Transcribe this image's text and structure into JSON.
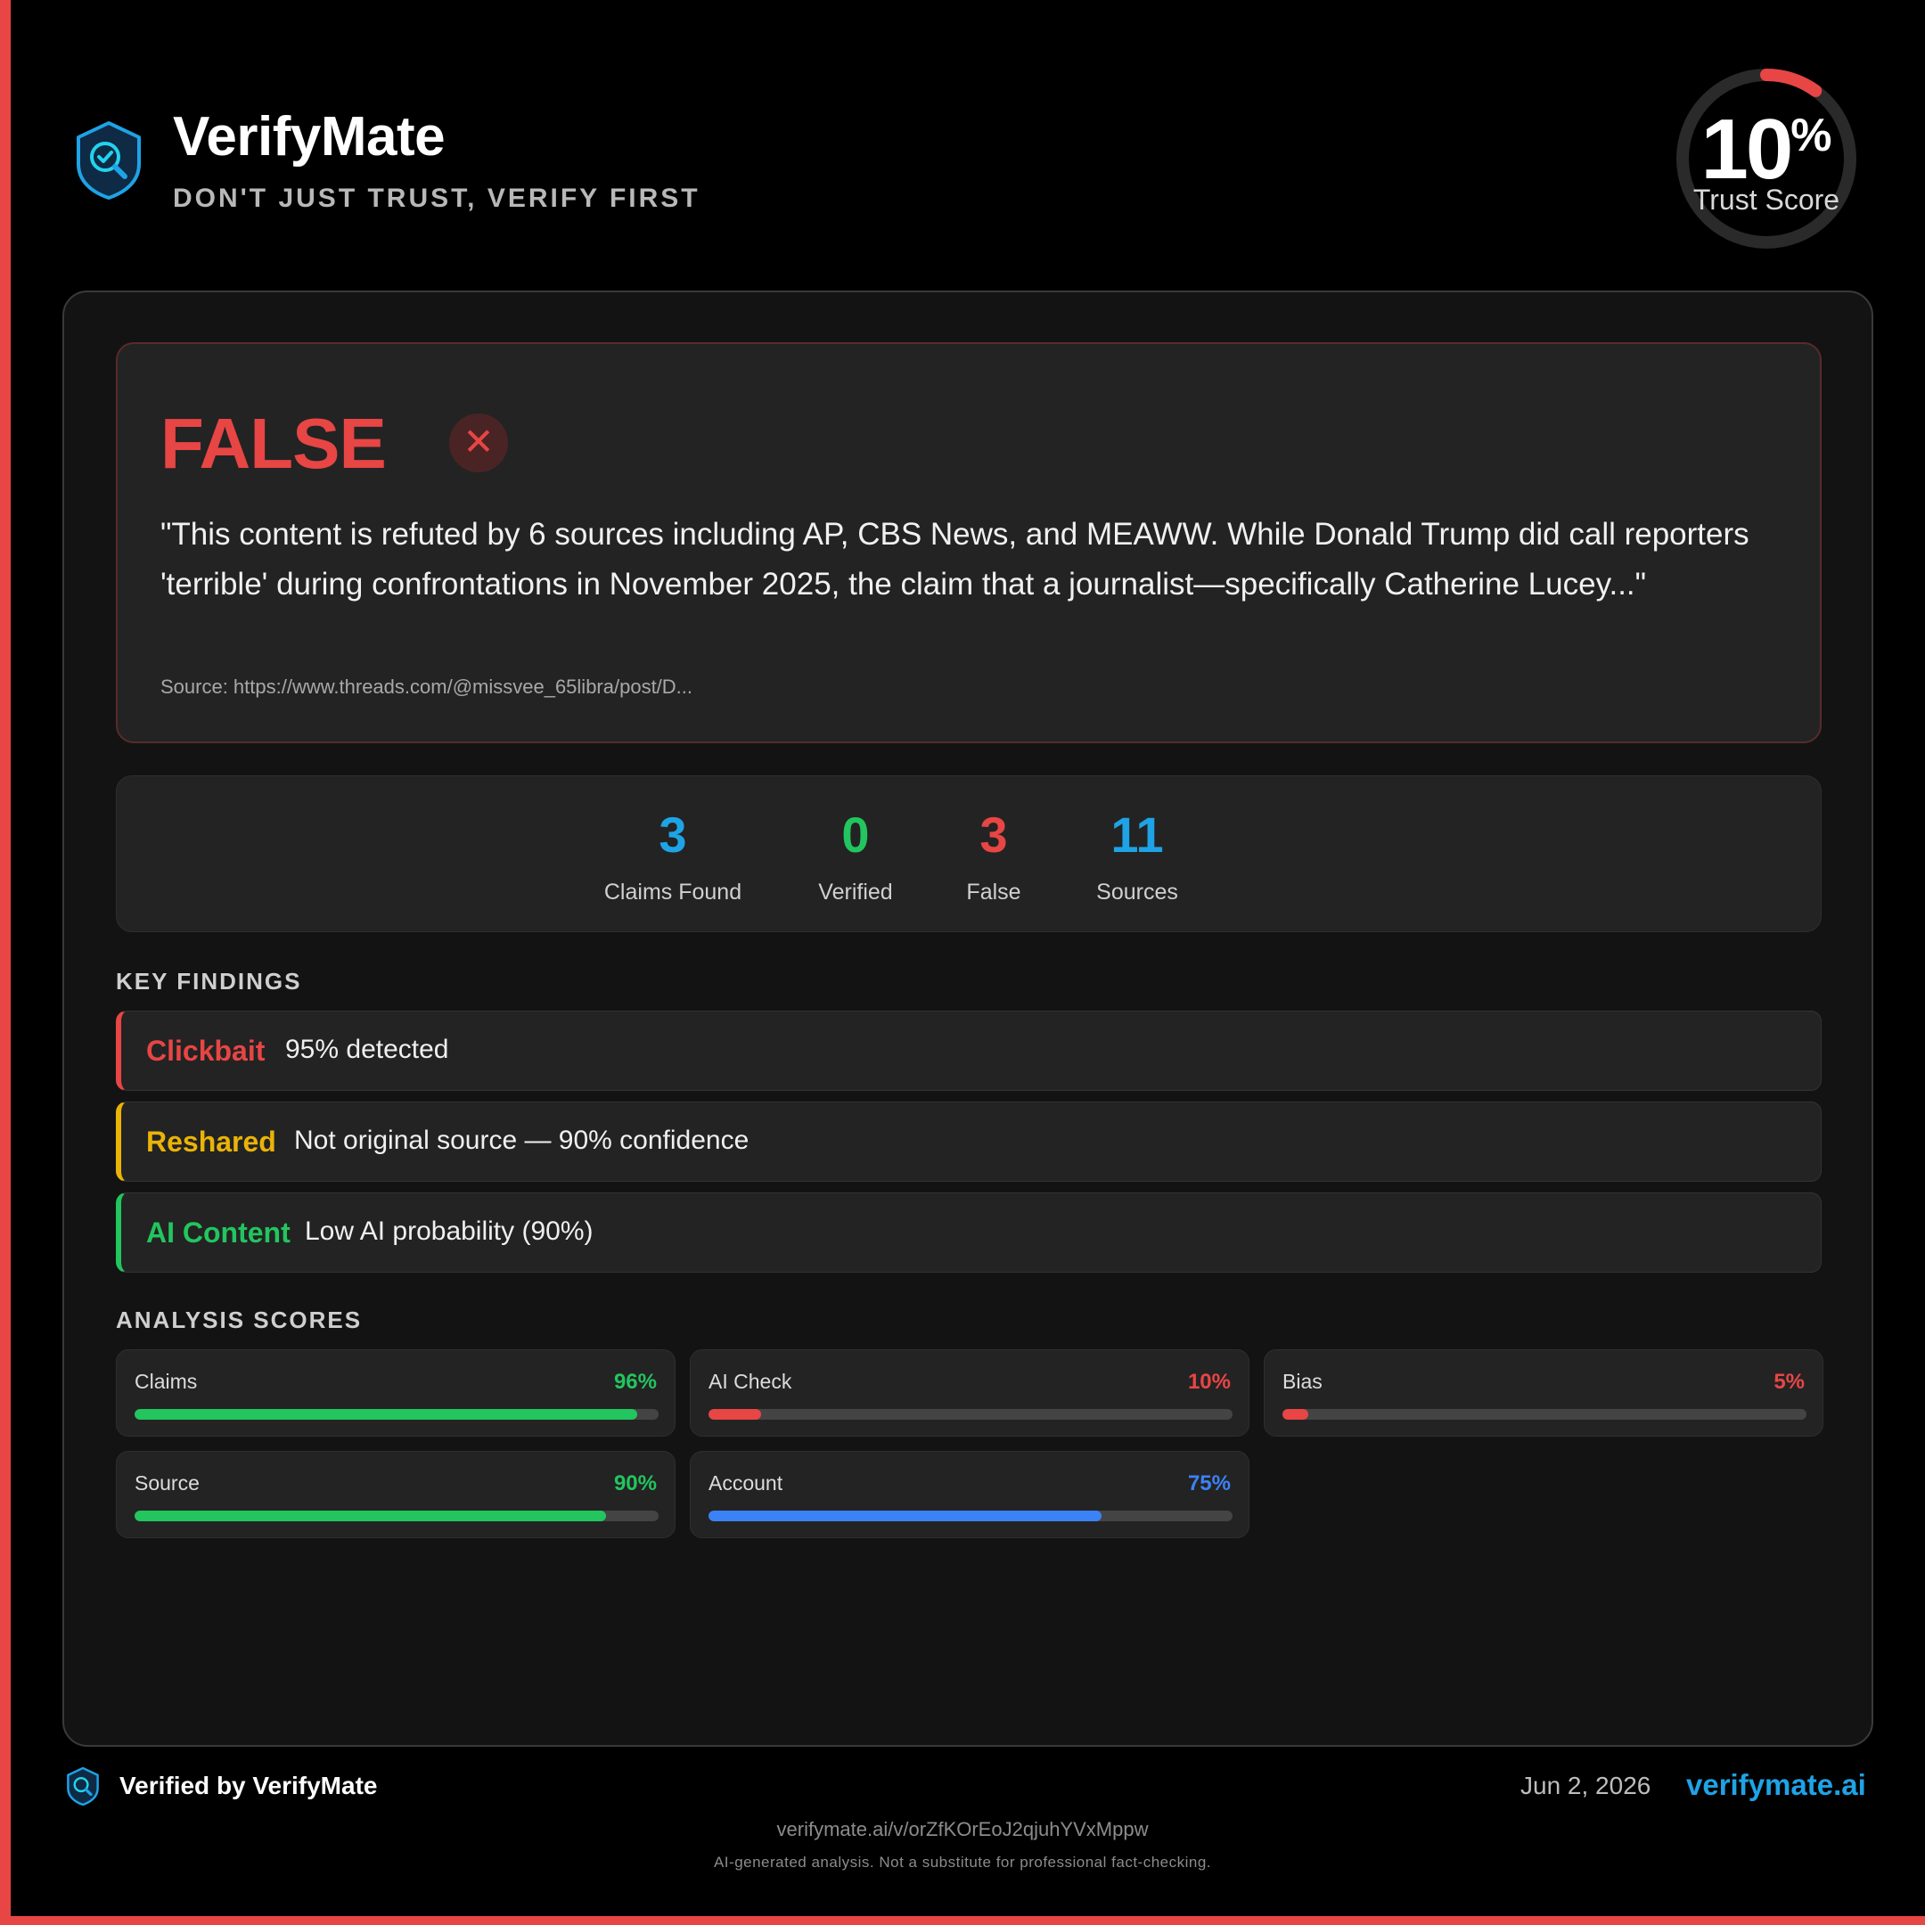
{
  "brand": {
    "name": "VerifyMate",
    "tagline": "DON'T JUST TRUST, VERIFY FIRST",
    "icon": "shield-check-icon"
  },
  "trust_score": {
    "value": "10",
    "unit": "%",
    "fraction": 0.1,
    "label": "Trust Score",
    "color": "#e84545"
  },
  "verdict": {
    "title": "FALSE",
    "icon": "close-icon",
    "quote": "\"This content is refuted by 6 sources including AP, CBS News, and MEAWW. While Donald Trump did call reporters 'terrible' during confrontations in November 2025, the claim that a journalist—specifically Catherine Lucey...\"",
    "source": "Source: https://www.threads.com/@missvee_65libra/post/D..."
  },
  "stats": [
    {
      "value": "3",
      "label": "Claims Found",
      "color": "#1ea3e6"
    },
    {
      "value": "0",
      "label": "Verified",
      "color": "#22c55e"
    },
    {
      "value": "3",
      "label": "False",
      "color": "#e84545"
    },
    {
      "value": "11",
      "label": "Sources",
      "color": "#1ea3e6"
    }
  ],
  "key_findings": {
    "heading": "KEY FINDINGS",
    "items": [
      {
        "tag": "Clickbait",
        "text": "95% detected",
        "color": "#e84545"
      },
      {
        "tag": "Reshared",
        "text": "Not original source — 90% confidence",
        "color": "#eab308"
      },
      {
        "tag": "AI Content",
        "text": "Low AI probability (90%)",
        "color": "#22c55e"
      }
    ]
  },
  "analysis_scores": {
    "heading": "ANALYSIS SCORES",
    "items": [
      {
        "label": "Claims",
        "value": "96%",
        "fraction": 0.96,
        "color": "#22c55e"
      },
      {
        "label": "AI Check",
        "value": "10%",
        "fraction": 0.1,
        "color": "#e84545"
      },
      {
        "label": "Bias",
        "value": "5%",
        "fraction": 0.05,
        "color": "#e84545"
      },
      {
        "label": "Source",
        "value": "90%",
        "fraction": 0.9,
        "color": "#22c55e"
      },
      {
        "label": "Account",
        "value": "75%",
        "fraction": 0.75,
        "color": "#3b82f6"
      }
    ]
  },
  "footer": {
    "verified": "Verified by VerifyMate",
    "date": "Jun 2, 2026",
    "domain": "verifymate.ai",
    "url": "verifymate.ai/v/orZfKOrEoJ2qjuhYVxMppw",
    "disclaimer": "AI-generated analysis. Not a substitute for professional fact-checking."
  },
  "colors": {
    "accent": "#e84545",
    "brand_blue": "#1ea3e6"
  }
}
